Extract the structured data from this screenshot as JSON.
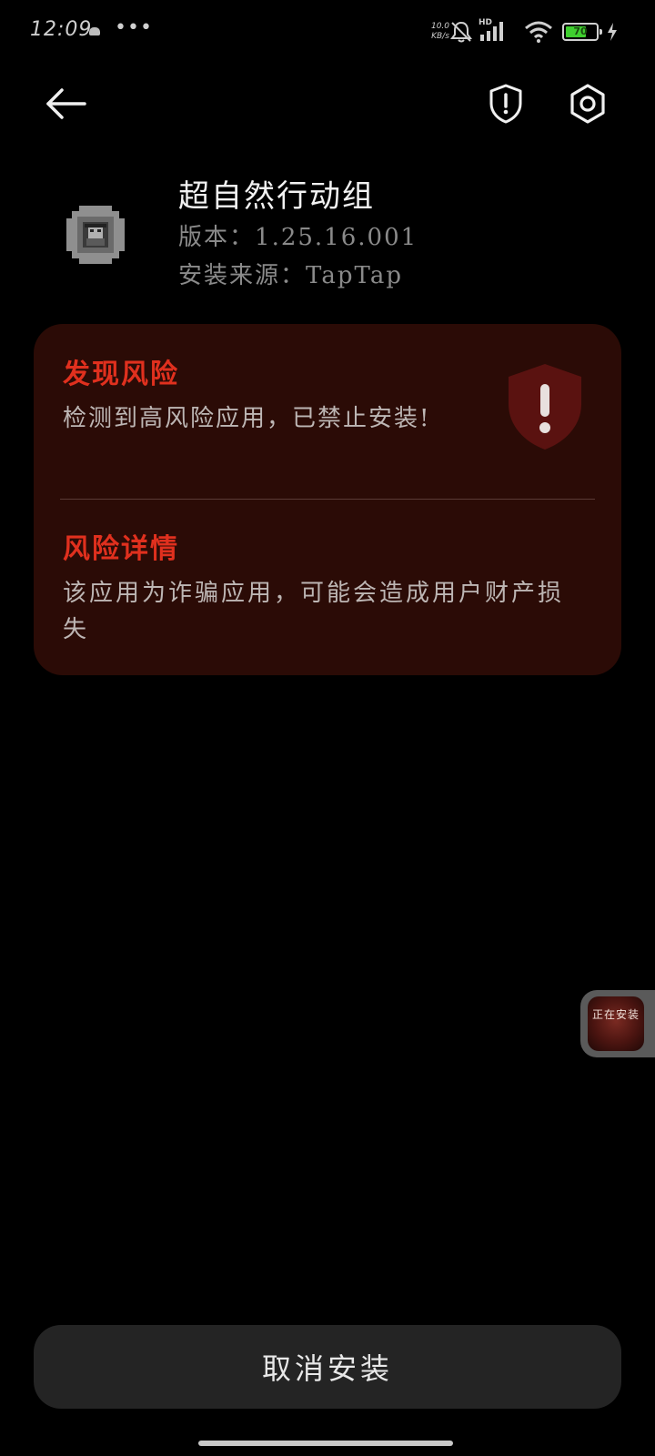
{
  "status_bar": {
    "time": "12:09",
    "more": "•••",
    "net_speed_value": "10.0",
    "net_speed_unit": "KB/s",
    "signal_label": "HD",
    "battery": "70",
    "battery_level": 0.7
  },
  "app": {
    "name": "超自然行动组",
    "version_label": "版本",
    "version_value": "1.25.16.001",
    "source_label": "安装来源",
    "source_value": "TapTap",
    "separator": "："
  },
  "risk": {
    "found_title": "发现风险",
    "found_desc": "检测到高风险应用，已禁止安装!",
    "detail_title": "风险详情",
    "detail_desc": "该应用为诈骗应用，可能会造成用户财产损失"
  },
  "install_bubble": {
    "label": "正在安装"
  },
  "actions": {
    "cancel_install": "取消安装"
  },
  "colors": {
    "background": "#000000",
    "card_background": "#2b0b06",
    "risk_red": "#e0301e",
    "battery_green": "#3fcf2f"
  }
}
